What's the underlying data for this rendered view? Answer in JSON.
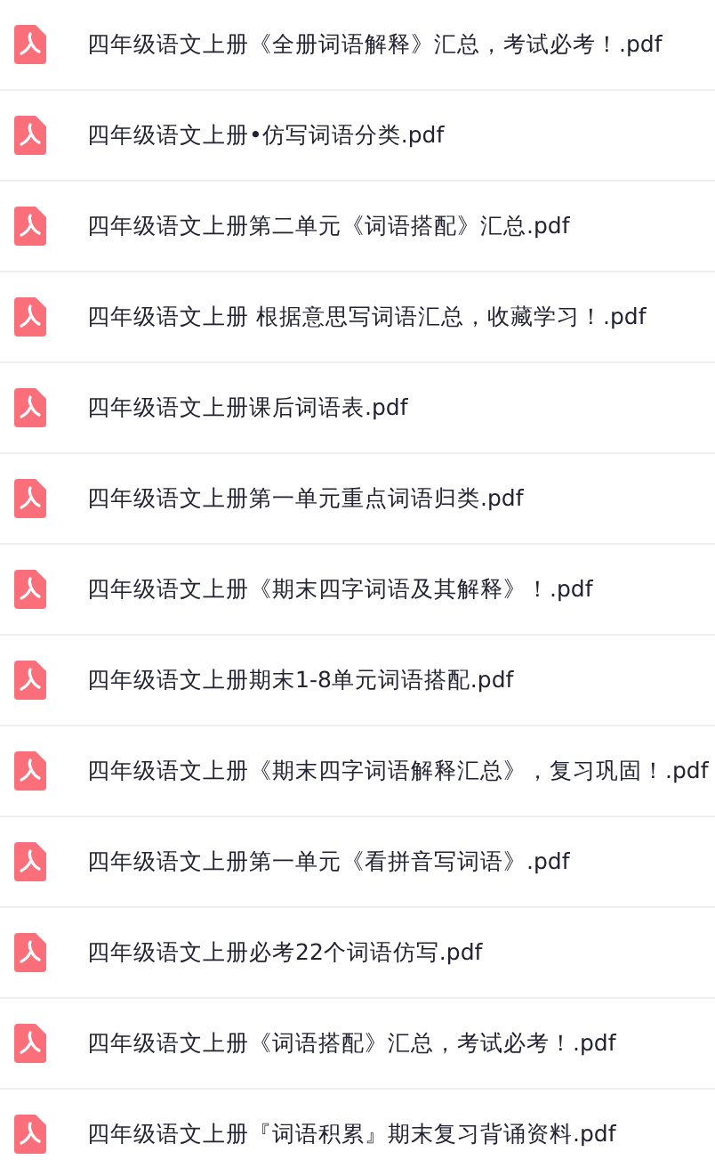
{
  "files": [
    {
      "name": "四年级语文上册《全册词语解释》汇总，考试必考！.pdf"
    },
    {
      "name": "四年级语文上册•仿写词语分类.pdf"
    },
    {
      "name": "四年级语文上册第二单元《词语搭配》汇总.pdf"
    },
    {
      "name": "四年级语文上册 根据意思写词语汇总，收藏学习！.pdf"
    },
    {
      "name": "四年级语文上册课后词语表.pdf"
    },
    {
      "name": "四年级语文上册第一单元重点词语归类.pdf"
    },
    {
      "name": "四年级语文上册《期末四字词语及其解释》！.pdf"
    },
    {
      "name": "四年级语文上册期末1-8单元词语搭配.pdf"
    },
    {
      "name": "四年级语文上册《期末四字词语解释汇总》，复习巩固！.pdf"
    },
    {
      "name": "四年级语文上册第一单元《看拼音写词语》.pdf"
    },
    {
      "name": "四年级语文上册必考22个词语仿写.pdf"
    },
    {
      "name": "四年级语文上册《词语搭配》汇总，考试必考！.pdf"
    },
    {
      "name": "四年级语文上册『词语积累』期末复习背诵资料.pdf"
    }
  ]
}
